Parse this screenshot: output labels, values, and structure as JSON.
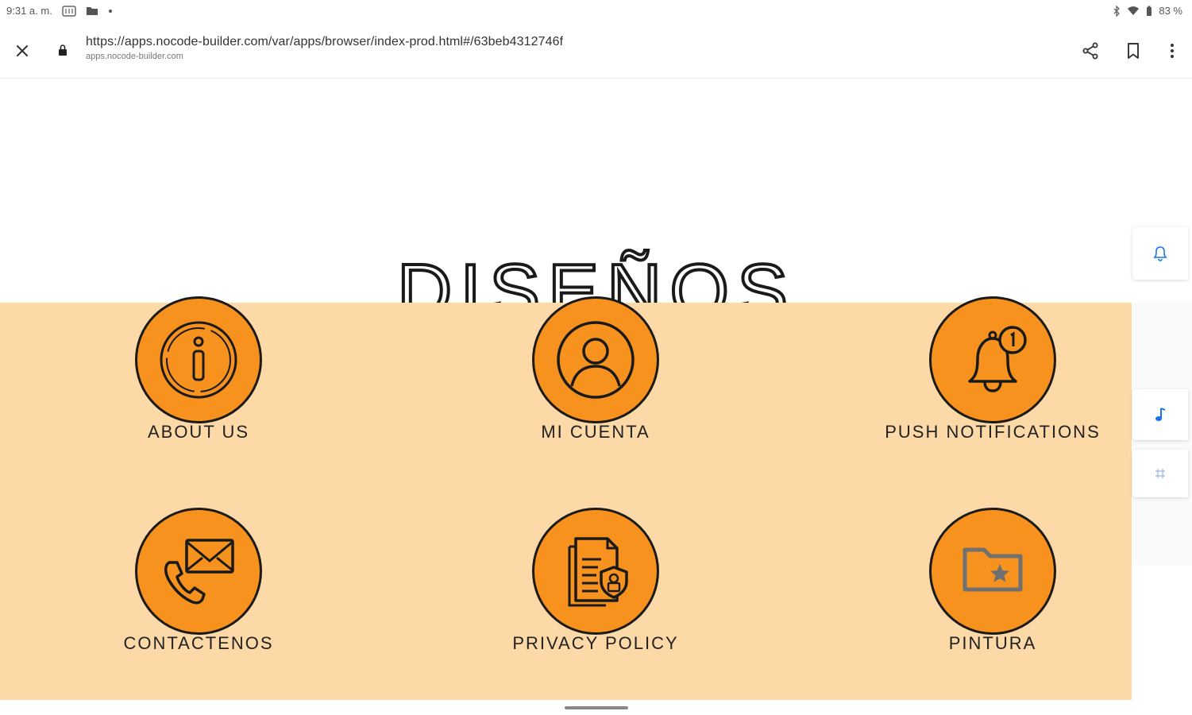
{
  "status_bar": {
    "time": "9:31 a. m.",
    "battery": "83 %"
  },
  "browser": {
    "url": "https://apps.nocode-builder.com/var/apps/browser/index-prod.html#/63beb4312746f",
    "domain": "apps.nocode-builder.com"
  },
  "page": {
    "title": "DISEÑOS",
    "tiles": [
      {
        "label": "ABOUT US",
        "icon": "info-icon"
      },
      {
        "label": "MI CUENTA",
        "icon": "user-icon"
      },
      {
        "label": "PUSH NOTIFICATIONS",
        "icon": "bell-icon"
      },
      {
        "label": "CONTACTENOS",
        "icon": "contact-icon"
      },
      {
        "label": "PRIVACY POLICY",
        "icon": "document-icon"
      },
      {
        "label": "PINTURA",
        "icon": "folder-star-icon"
      }
    ]
  },
  "colors": {
    "panel": "#fcd9a6",
    "circle": "#f7921e",
    "accent_blue": "#1a73e8"
  }
}
